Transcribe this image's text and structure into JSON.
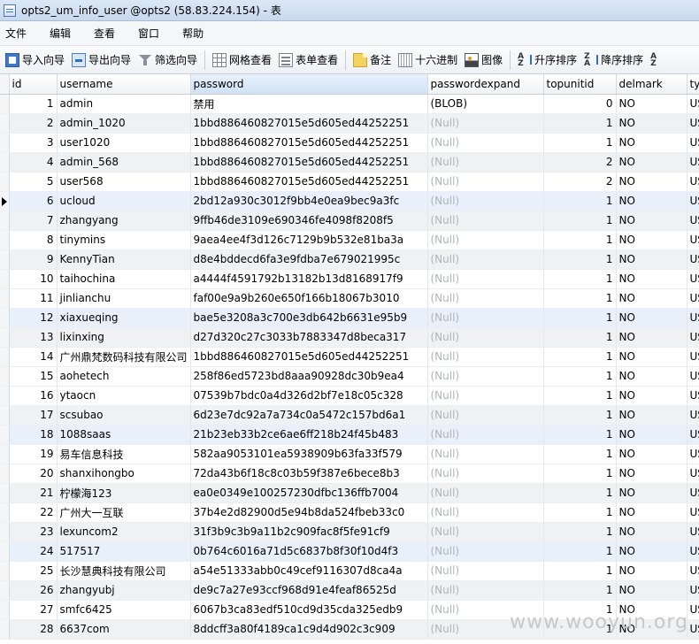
{
  "window": {
    "title": "opts2_um_info_user @opts2 (58.83.224.154) - 表"
  },
  "menu": [
    "文件",
    "编辑",
    "查看",
    "窗口",
    "帮助"
  ],
  "toolbar": {
    "import_wizard": "导入向导",
    "export_wizard": "导出向导",
    "filter_wizard": "筛选向导",
    "grid_view": "网格查看",
    "form_view": "表单查看",
    "memo": "备注",
    "hex": "十六进制",
    "image": "图像",
    "sort_asc": "升序排序",
    "sort_desc": "降序排序",
    "sort_asc_icon_text": "A",
    "sort_asc_icon_text2": "Z",
    "sort_desc_icon_text": "Z",
    "sort_desc_icon_text2": "A"
  },
  "grid": {
    "columns": [
      "id",
      "username",
      "password",
      "passwordexpand",
      "topunitid",
      "delmark",
      "ty"
    ],
    "rows": [
      [
        "1",
        "admin",
        "禁用",
        "(BLOB)",
        "0",
        "NO",
        "US"
      ],
      [
        "2",
        "admin_1020",
        "1bbd886460827015e5d605ed44252251",
        "(Null)",
        "1",
        "NO",
        "US"
      ],
      [
        "3",
        "user1020",
        "1bbd886460827015e5d605ed44252251",
        "(Null)",
        "1",
        "NO",
        "US"
      ],
      [
        "4",
        "admin_568",
        "1bbd886460827015e5d605ed44252251",
        "(Null)",
        "2",
        "NO",
        "US"
      ],
      [
        "5",
        "user568",
        "1bbd886460827015e5d605ed44252251",
        "(Null)",
        "2",
        "NO",
        "US"
      ],
      [
        "6",
        "ucloud",
        "2bd12a930c3012f9bb4e0ea9bec9a3fc",
        "(Null)",
        "1",
        "NO",
        "US"
      ],
      [
        "7",
        "zhangyang",
        "9ffb46de3109e690346fe4098f8208f5",
        "(Null)",
        "1",
        "NO",
        "US"
      ],
      [
        "8",
        "tinymins",
        "9aea4ee4f3d126c7129b9b532e81ba3a",
        "(Null)",
        "1",
        "NO",
        "US"
      ],
      [
        "9",
        "KennyTian",
        "d8e4bddecd6fa3e9fdba7e679021995c",
        "(Null)",
        "1",
        "NO",
        "US"
      ],
      [
        "10",
        "taihochina",
        "a4444f4591792b13182b13d8168917f9",
        "(Null)",
        "1",
        "NO",
        "US"
      ],
      [
        "11",
        "jinlianchu",
        "faf00e9a9b260e650f166b18067b3010",
        "(Null)",
        "1",
        "NO",
        "US"
      ],
      [
        "12",
        "xiaxueqing",
        "bae5e3208a3c700e3db642b6631e95b9",
        "(Null)",
        "1",
        "NO",
        "US"
      ],
      [
        "13",
        "lixinxing",
        "d27d320c27c3033b7883347d8beca317",
        "(Null)",
        "1",
        "NO",
        "US"
      ],
      [
        "14",
        "广州鼎梵数码科技有限公司",
        "1bbd886460827015e5d605ed44252251",
        "(Null)",
        "1",
        "NO",
        "US"
      ],
      [
        "15",
        "aohetech",
        "258f86ed5723bd8aaa90928dc30b9ea4",
        "(Null)",
        "1",
        "NO",
        "US"
      ],
      [
        "16",
        "ytaocn",
        "07539b7bdc0a4d326d2bf7e18c05c328",
        "(Null)",
        "1",
        "NO",
        "US"
      ],
      [
        "17",
        "scsubao",
        "6d23e7dc92a7a734c0a5472c157bd6a1",
        "(Null)",
        "1",
        "NO",
        "US"
      ],
      [
        "18",
        "1088saas",
        "21b23eb33b2ce6ae6ff218b24f45b483",
        "(Null)",
        "1",
        "NO",
        "US"
      ],
      [
        "19",
        "易车信息科技",
        "582aa9053101ea5938909b63fa33f579",
        "(Null)",
        "1",
        "NO",
        "US"
      ],
      [
        "20",
        "shanxihongbo",
        "72da43b6f18c8c03b59f387e6bece8b3",
        "(Null)",
        "1",
        "NO",
        "US"
      ],
      [
        "21",
        "柠檬海123",
        "ea0e0349e100257230dfbc136ffb7004",
        "(Null)",
        "1",
        "NO",
        "US"
      ],
      [
        "22",
        "广州大一互联",
        "37b4e2d82900d5e94b8da524fbeb33c0",
        "(Null)",
        "1",
        "NO",
        "US"
      ],
      [
        "23",
        "lexuncom2",
        "31f3b9c3b9a11b2c909fac8f5fe91cf9",
        "(Null)",
        "1",
        "NO",
        "US"
      ],
      [
        "24",
        "517517",
        "0b764c6016a71d5c6837b8f30f10d4f3",
        "(Null)",
        "1",
        "NO",
        "US"
      ],
      [
        "25",
        "长沙慧典科技有限公司",
        "a54e51333abb0c49cef9116307d8ca4a",
        "(Null)",
        "1",
        "NO",
        "US"
      ],
      [
        "26",
        "zhangyubj",
        "de9c7a27e93ccf968d91e4feaf86525d",
        "(Null)",
        "1",
        "NO",
        "US"
      ],
      [
        "27",
        "smfc6425",
        "6067b3ca83edf510cd9d35cda325edb9",
        "(Null)",
        "1",
        "NO",
        "US"
      ],
      [
        "28",
        "6637com",
        "8ddcff3a80f4189ca1c9d4d902c3c909",
        "(Null)",
        "1",
        "NO",
        "US"
      ]
    ]
  },
  "watermark": "www.wooyun.org"
}
